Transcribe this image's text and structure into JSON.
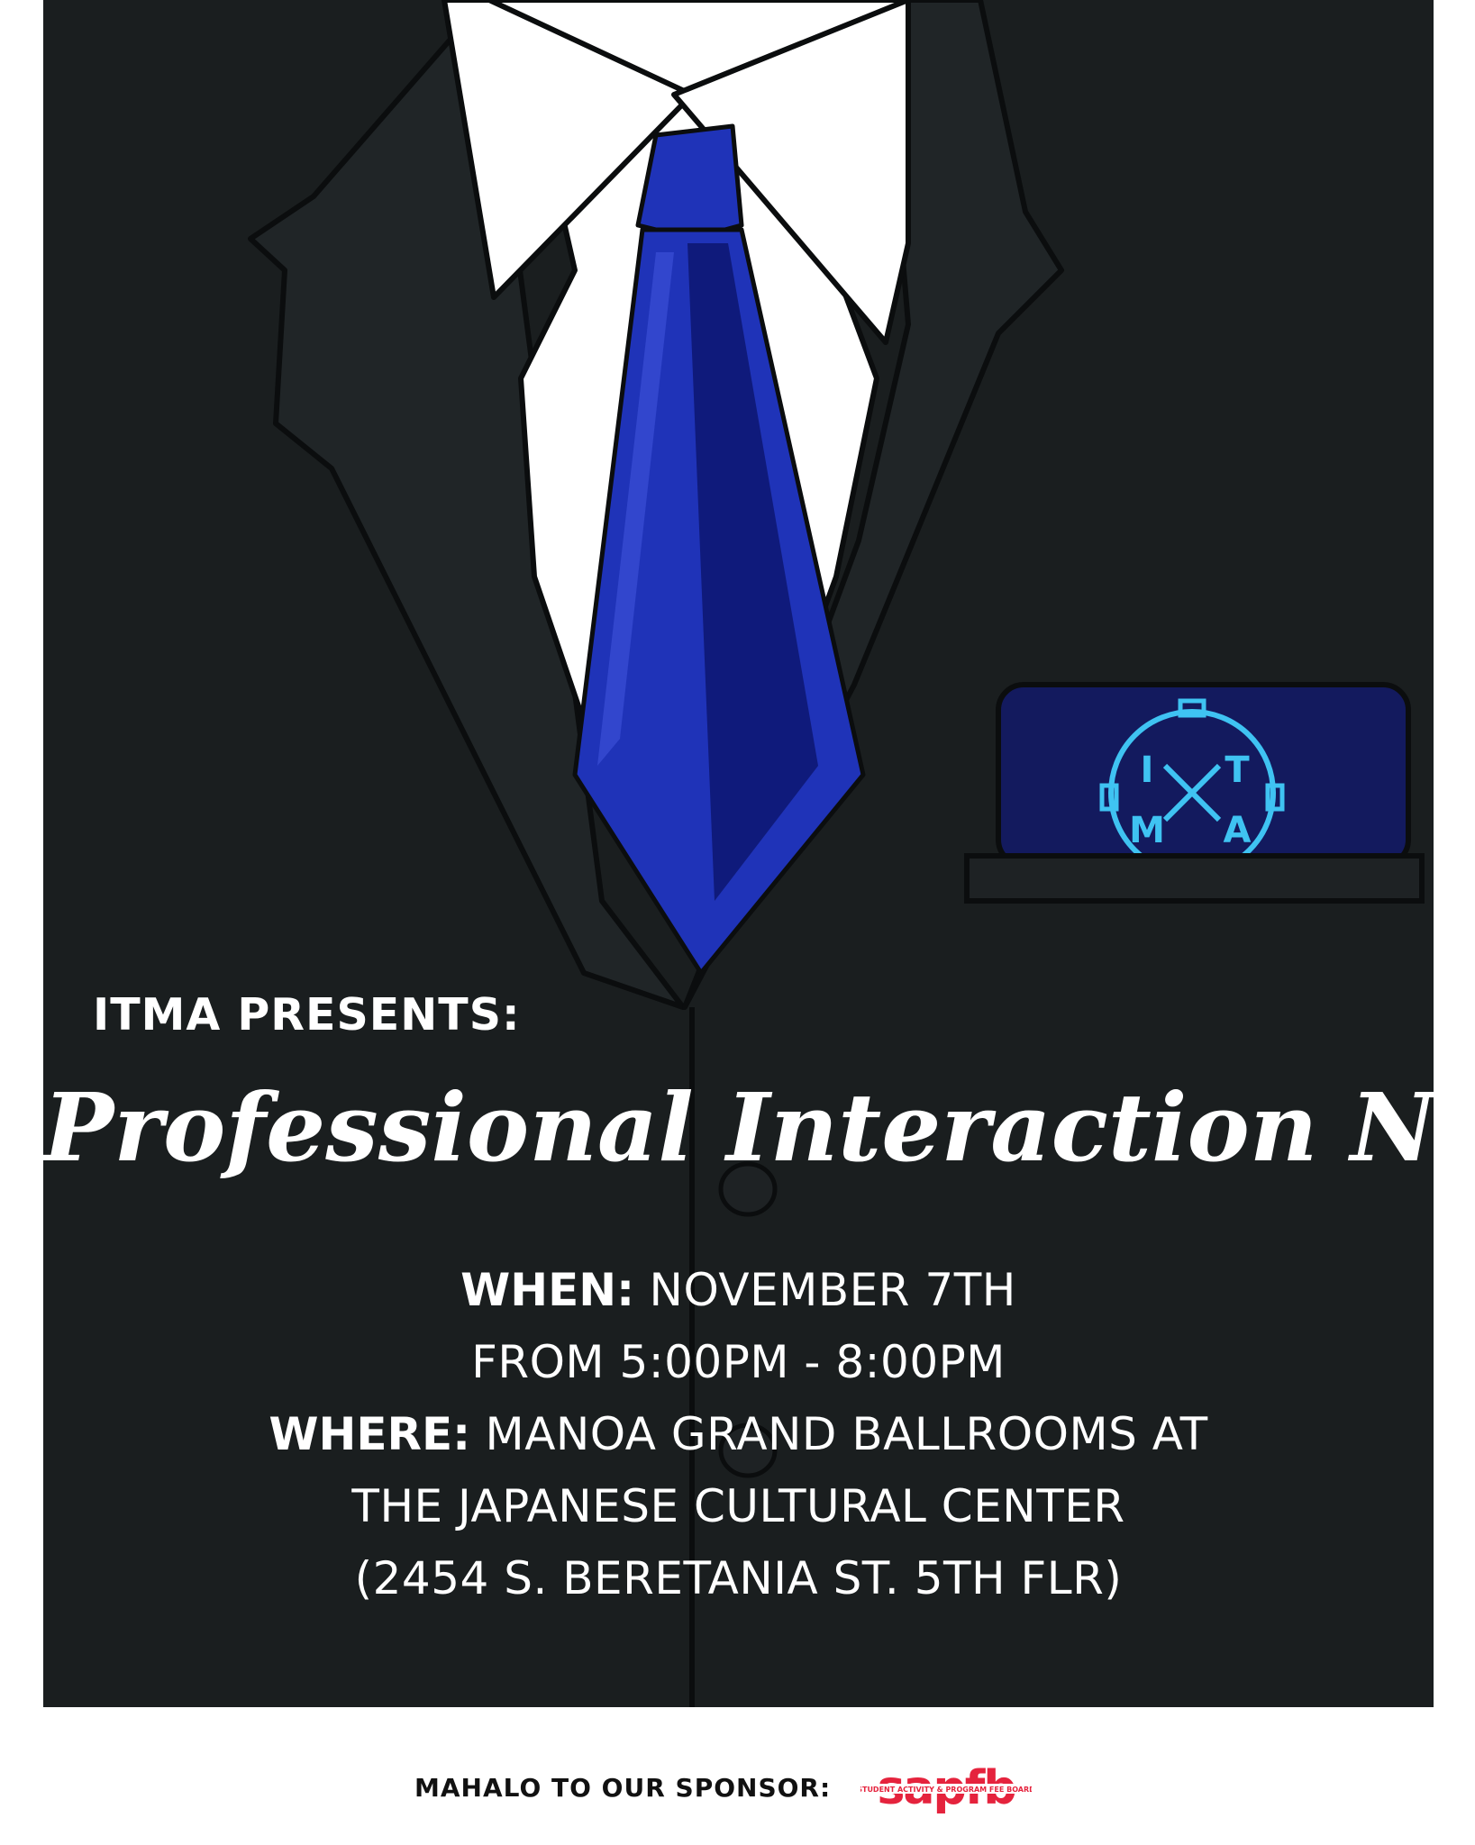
{
  "poster": {
    "presenter": "ITMA PRESENTS:",
    "title": "Professional Interaction Night",
    "when_label": "WHEN:",
    "when_value": " NOVEMBER 7TH",
    "time": "FROM 5:00PM - 8:00PM",
    "where_label": "WHERE:",
    "where_value": " MANOA GRAND BALLROOMS AT",
    "venue": "THE JAPANESE CULTURAL CENTER",
    "address": "(2454 S. BERETANIA ST. 5TH FLR)"
  },
  "badge": {
    "letters": [
      "I",
      "T",
      "M",
      "A"
    ]
  },
  "footer": {
    "sponsor_label": "MAHALO TO OUR SPONSOR:",
    "sponsor_logo": "sapfb",
    "sponsor_tagline": "STUDENT ACTIVITY & PROGRAM FEE BOARD"
  },
  "colors": {
    "suit": "#1a1e1f",
    "shirt": "#ffffff",
    "tie": "#1f33b8",
    "tie_dark": "#0d1670",
    "pocket_square": "#131a5e",
    "logo_glow": "#3fc3f2",
    "sponsor_red": "#e5233d"
  }
}
